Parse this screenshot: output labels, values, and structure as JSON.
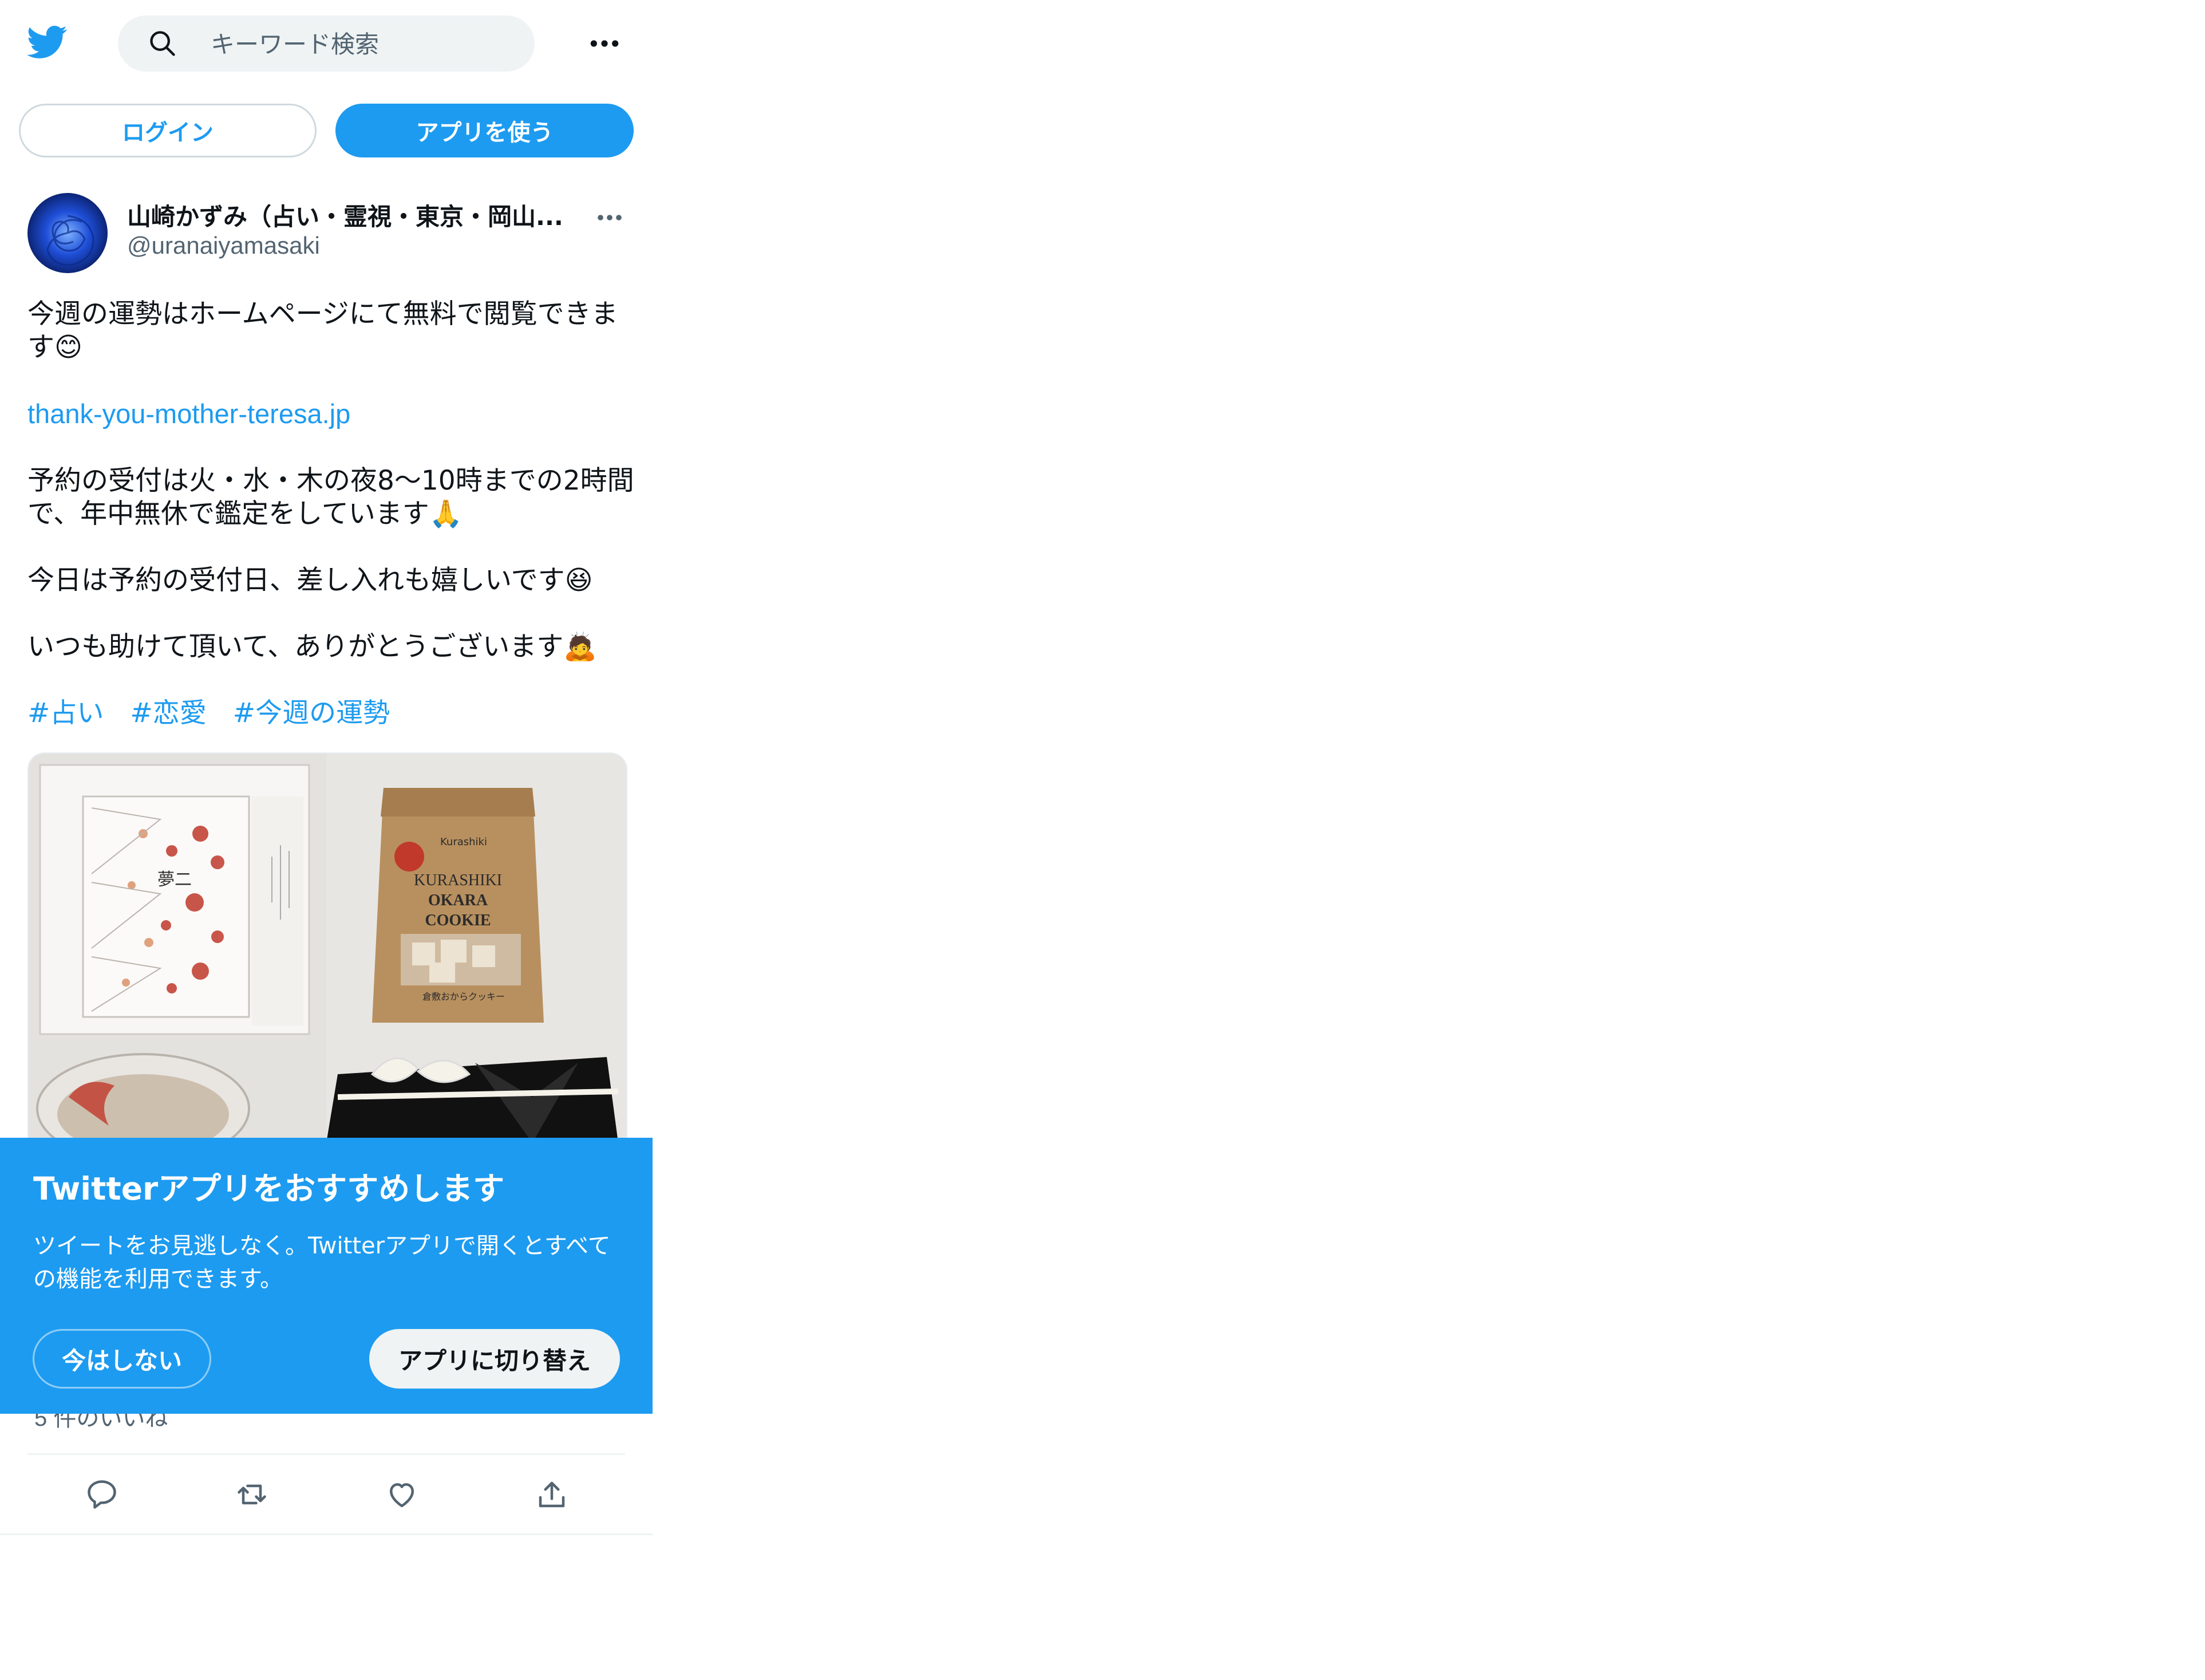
{
  "colors": {
    "brand": "#1d9bf0",
    "text_primary": "#0f1419",
    "text_secondary": "#536471",
    "search_bg": "#eff3f4"
  },
  "header": {
    "logo_icon": "twitter-bird-icon",
    "search_placeholder": "キーワード検索",
    "more_icon": "more-horizontal-icon"
  },
  "auth": {
    "login_label": "ログイン",
    "use_app_label": "アプリを使う"
  },
  "tweet": {
    "display_name": "山崎かずみ（占い・霊視・東京・岡山...",
    "handle": "@uranaiyamasaki",
    "text": {
      "p1": "今週の運勢はホームページにて無料で閲覧できます😊",
      "link": "thank-you-mother-teresa.jp",
      "p2": "予約の受付は火・水・木の夜8〜10時までの2時間で、年中無休で鑑定をしています🙏",
      "p3": "今日は予約の受付日、差し入れも嬉しいです😆",
      "p4": "いつも助けて頂いて、ありがとうございます🙇",
      "hashtags": [
        "#占い",
        "#恋愛",
        "#今週の運勢"
      ]
    },
    "likes_text": "5 件のいいね",
    "actions": {
      "reply_icon": "reply-icon",
      "retweet_icon": "retweet-icon",
      "like_icon": "heart-icon",
      "share_icon": "share-icon"
    }
  },
  "promo": {
    "title": "Twitterアプリをおすすめします",
    "body": "ツイートをお見逃しなく。Twitterアプリで開くとすべての機能を利用できます。",
    "dismiss_label": "今はしない",
    "switch_label": "アプリに切り替え"
  },
  "media": {
    "left_box_label": "夢二",
    "bag_brand": "Kurashiki",
    "bag_line1": "KURASHIKI",
    "bag_line2": "OKARA",
    "bag_line3": "COOKIE",
    "bag_sub": "倉敷おからクッキー"
  }
}
